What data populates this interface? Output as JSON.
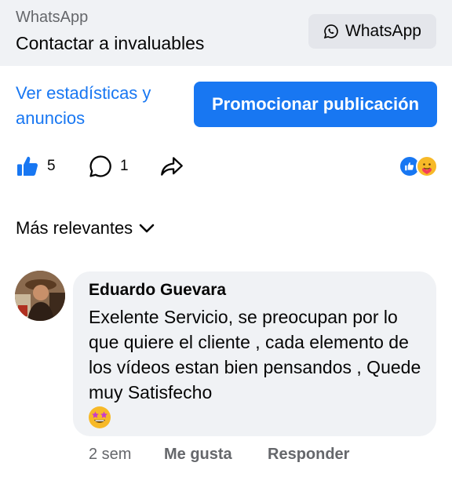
{
  "whatsapp_banner": {
    "source": "WhatsApp",
    "title": "Contactar a invaluables",
    "button_label": "WhatsApp"
  },
  "post_actions": {
    "stats_link": "Ver estadísticas y anuncios",
    "promote_label": "Promocionar publicación",
    "like_count": "5",
    "comment_count": "1",
    "reaction_icons": [
      "like-reaction-icon",
      "care-reaction-icon"
    ]
  },
  "comments_section": {
    "sort_label": "Más relevantes"
  },
  "comment": {
    "author": "Eduardo Guevara",
    "text": "Exelente Servicio, se preocupan por lo que quiere el cliente , cada elemento de los vídeos estan bien pensandos , Quede muy Satisfecho",
    "emoji": "star-struck-emoji",
    "time": "2 sem",
    "like_label": "Me gusta",
    "reply_label": "Responder"
  },
  "colors": {
    "accent": "#1877f2",
    "muted": "#65676b",
    "banner_bg": "#f0f2f5"
  }
}
